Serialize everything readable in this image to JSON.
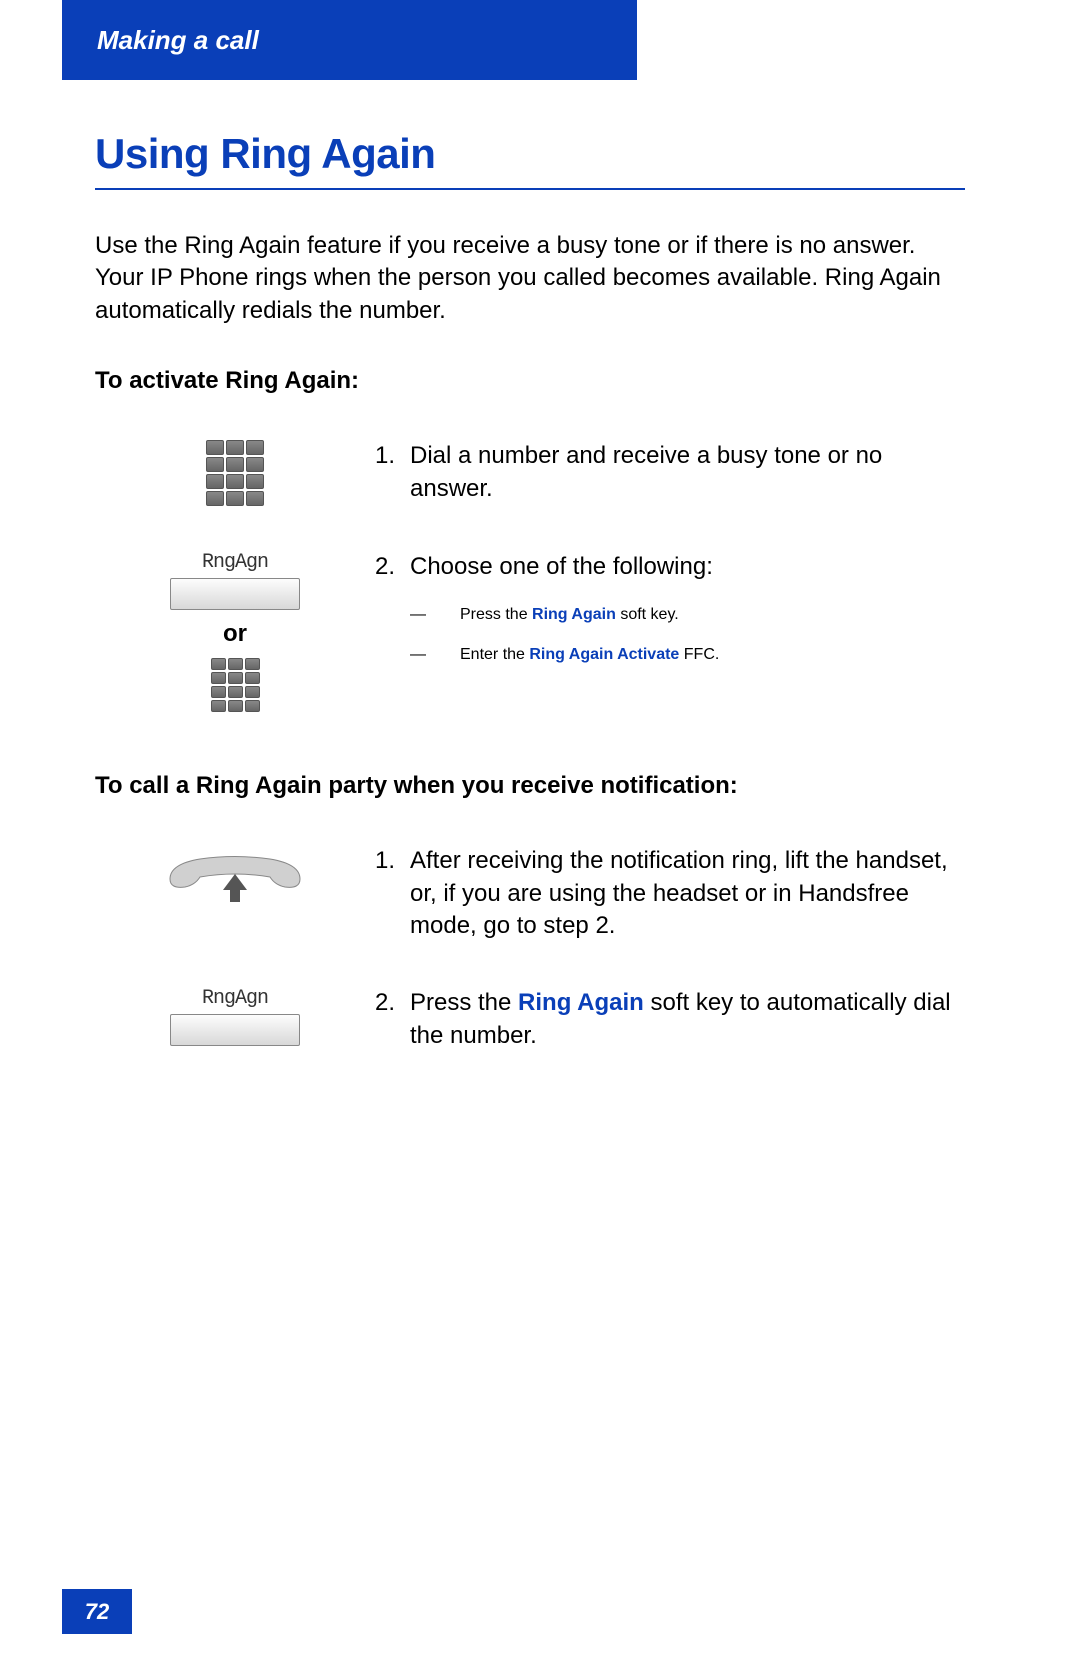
{
  "header": {
    "chapter": "Making a call"
  },
  "title": "Using Ring Again",
  "intro": "Use the Ring Again feature if you receive a busy tone or if there is no answer. Your IP Phone rings when the person you called becomes available. Ring Again automatically redials the number.",
  "section1": {
    "heading": "To activate Ring Again:",
    "softkey_label": "RngAgn",
    "or_label": "or",
    "step1_num": "1.",
    "step1_text": "Dial a number and receive a busy tone or no answer.",
    "step2_num": "2.",
    "step2_text": "Choose one of the following:",
    "bullet1_dash": "—",
    "bullet1_pre": "Press the ",
    "bullet1_highlight": "Ring Again",
    "bullet1_post": " soft key.",
    "bullet2_dash": "—",
    "bullet2_pre": "Enter the ",
    "bullet2_highlight": "Ring Again Activate",
    "bullet2_post": " FFC."
  },
  "section2": {
    "heading": "To call a Ring Again party when you receive notification:",
    "softkey_label": "RngAgn",
    "step1_num": "1.",
    "step1_text": "After receiving the notification ring, lift the handset, or, if you are using the headset or in Handsfree mode, go to step 2.",
    "step2_num": "2.",
    "step2_pre": "Press the ",
    "step2_highlight": "Ring Again",
    "step2_post": " soft key to automatically dial the number."
  },
  "page_number": "72"
}
